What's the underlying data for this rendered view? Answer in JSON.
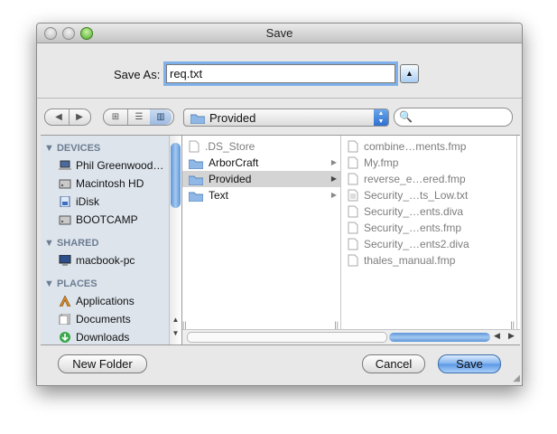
{
  "window": {
    "title": "Save"
  },
  "save_as": {
    "label": "Save As:",
    "value": "req.txt"
  },
  "toolbar": {
    "back": "◀",
    "forward": "▶",
    "views": [
      "⊞",
      "☰",
      "▥"
    ],
    "location": "Provided",
    "search_value": ""
  },
  "sidebar": {
    "sections": [
      {
        "label": "DEVICES",
        "items": [
          {
            "label": "Phil Greenwood…",
            "icon": "laptop-icon"
          },
          {
            "label": "Macintosh HD",
            "icon": "hard-drive-icon"
          },
          {
            "label": "iDisk",
            "icon": "idisk-icon"
          },
          {
            "label": "BOOTCAMP",
            "icon": "hard-drive-icon"
          }
        ]
      },
      {
        "label": "SHARED",
        "items": [
          {
            "label": "macbook-pc",
            "icon": "network-computer-icon"
          }
        ]
      },
      {
        "label": "PLACES",
        "items": [
          {
            "label": "Applications",
            "icon": "applications-icon"
          },
          {
            "label": "Documents",
            "icon": "documents-icon"
          },
          {
            "label": "Downloads",
            "icon": "downloads-icon"
          }
        ]
      }
    ]
  },
  "column1": [
    {
      "name": ".DS_Store",
      "type": "file",
      "dim": true
    },
    {
      "name": "ArborCraft",
      "type": "folder"
    },
    {
      "name": "Provided",
      "type": "folder",
      "selected": true
    },
    {
      "name": "Text",
      "type": "folder"
    }
  ],
  "column2": [
    "combine…ments.fmp",
    "My.fmp",
    "reverse_e…ered.fmp",
    "Security_…ts_Low.txt",
    "Security_…ents.diva",
    "Security_…ents.fmp",
    "Security_…ents2.diva",
    "thales_manual.fmp"
  ],
  "buttons": {
    "new_folder": "New Folder",
    "cancel": "Cancel",
    "save": "Save"
  },
  "colors": {
    "accent": "#5b97e4",
    "sidebar_bg": "#dde4ec",
    "selection": "#d4d4d4"
  }
}
